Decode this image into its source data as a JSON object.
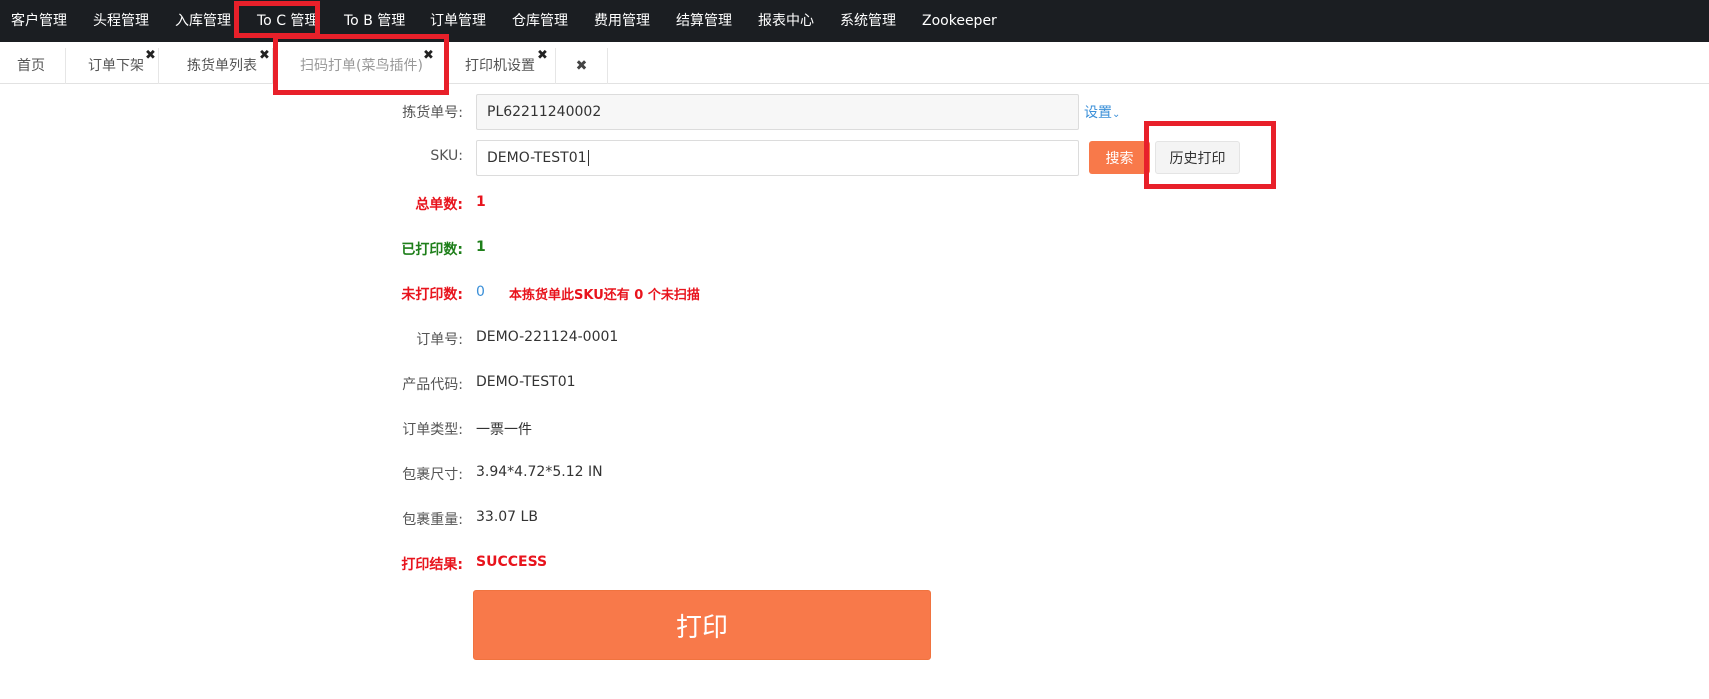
{
  "nav": {
    "items": [
      "客户管理",
      "头程管理",
      "入库管理",
      "To C 管理",
      "To B 管理",
      "订单管理",
      "仓库管理",
      "费用管理",
      "结算管理",
      "报表中心",
      "系统管理",
      "Zookeeper"
    ]
  },
  "tabs": {
    "items": [
      "首页",
      "订单下架",
      "拣货单列表",
      "扫码打单(菜鸟插件)",
      "打印机设置"
    ],
    "close_glyph": "✖"
  },
  "form": {
    "picking_label": "拣货单号:",
    "picking_value": "PL62211240002",
    "settings_link": "设置",
    "sku_label": "SKU:",
    "sku_value": "DEMO-TEST01",
    "search_button": "搜索",
    "history_button": "历史打印",
    "total_label": "总单数:",
    "total_value": "1",
    "printed_label": "已打印数:",
    "printed_value": "1",
    "unprinted_label": "未打印数:",
    "unprinted_value": "0",
    "unscanned_msg": "本拣货单此SKU还有 0 个未扫描",
    "order_no_label": "订单号:",
    "order_no_value": "DEMO-221124-0001",
    "product_code_label": "产品代码:",
    "product_code_value": "DEMO-TEST01",
    "order_type_label": "订单类型:",
    "order_type_value": "一票一件",
    "package_size_label": "包裹尺寸:",
    "package_size_value": "3.94*4.72*5.12 IN",
    "package_weight_label": "包裹重量:",
    "package_weight_value": "33.07 LB",
    "print_result_label": "打印结果:",
    "print_result_value": "SUCCESS",
    "print_button": "打印"
  },
  "colors": {
    "nav_bg": "#1b1e22",
    "accent_orange": "#f8794a",
    "highlight_red": "#e8202a",
    "status_red": "#e8141d",
    "status_green": "#1e7f1a",
    "link_blue": "#3a8fd8"
  }
}
